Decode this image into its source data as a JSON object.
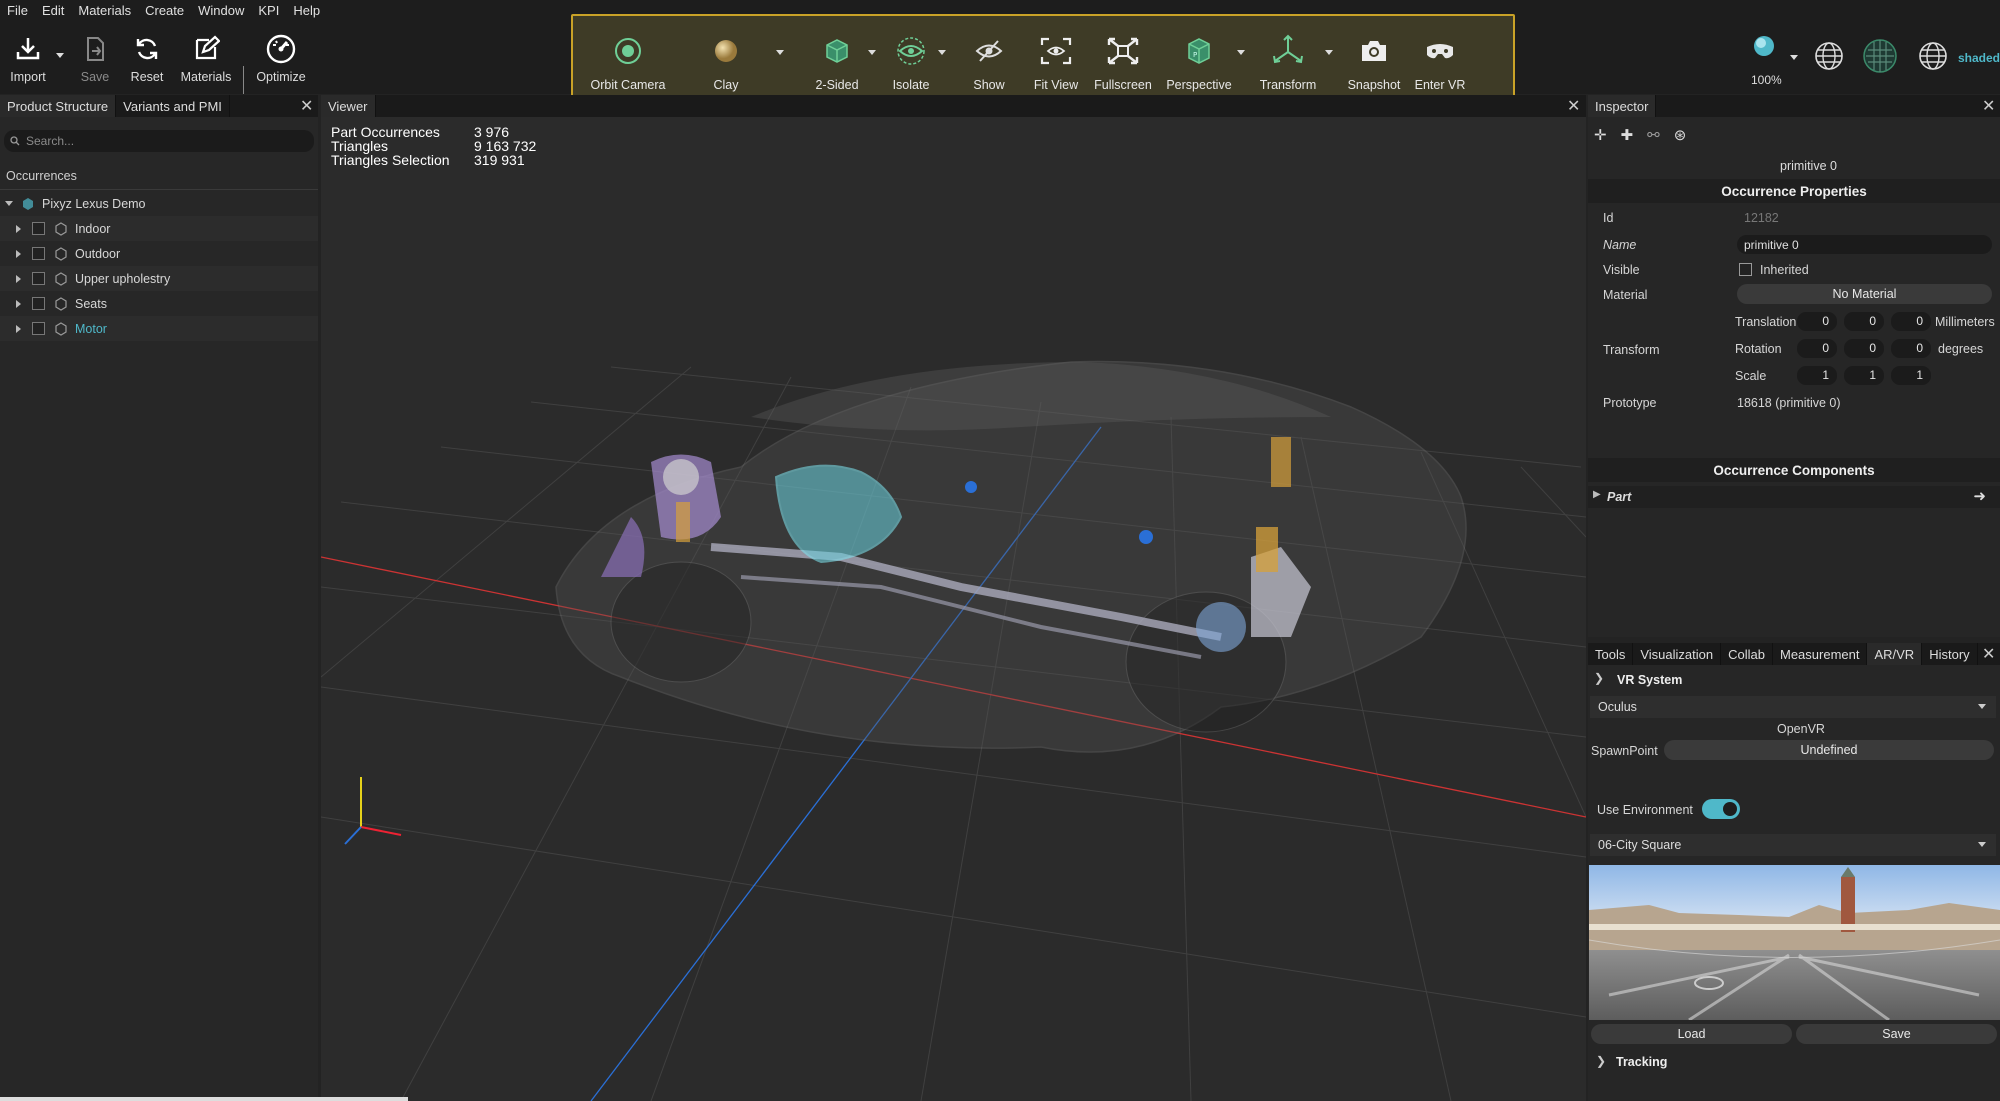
{
  "menu": [
    "File",
    "Edit",
    "Materials",
    "Create",
    "Window",
    "KPI",
    "Help"
  ],
  "toolbar": {
    "import": "Import",
    "save": "Save",
    "reset": "Reset",
    "materials": "Materials",
    "optimize": "Optimize"
  },
  "viewer_tools": {
    "orbit": "Orbit Camera",
    "clay": "Clay",
    "two_sided": "2-Sided",
    "isolate": "Isolate",
    "show": "Show",
    "fit": "Fit View",
    "fullscreen": "Fullscreen",
    "perspective": "Perspective",
    "transform": "Transform",
    "snapshot": "Snapshot",
    "vr": "Enter VR"
  },
  "right_tools": {
    "zoom": "100%",
    "shaded": "shaded"
  },
  "left_panel": {
    "tabs": [
      "Product Structure",
      "Variants and PMI"
    ],
    "search_placeholder": "Search...",
    "occurrences_label": "Occurrences",
    "root": "Pixyz Lexus Demo",
    "items": [
      "Indoor",
      "Outdoor",
      "Upper upholestry",
      "Seats",
      "Motor"
    ]
  },
  "viewer": {
    "tab": "Viewer",
    "stats": [
      {
        "k": "Part Occurrences",
        "v": "3 976"
      },
      {
        "k": "Triangles",
        "v": "9 163 732"
      },
      {
        "k": "Triangles Selection",
        "v": "319 931"
      }
    ]
  },
  "inspector": {
    "tab": "Inspector",
    "title": "primitive 0",
    "occ_props": "Occurrence Properties",
    "id_label": "Id",
    "id_value": "12182",
    "name_label": "Name",
    "name_value": "primitive 0",
    "visible_label": "Visible",
    "inherited": "Inherited",
    "material_label": "Material",
    "material_value": "No Material",
    "transform_label": "Transform",
    "translation": "Translation",
    "translation_values": [
      "0",
      "0",
      "0"
    ],
    "translation_unit": "Millimeters",
    "rotation": "Rotation",
    "rotation_values": [
      "0",
      "0",
      "0"
    ],
    "rotation_unit": "degrees",
    "scale": "Scale",
    "scale_values": [
      "1",
      "1",
      "1"
    ],
    "prototype_label": "Prototype",
    "prototype_value": "18618 (primitive 0)",
    "occ_comps": "Occurrence Components",
    "part": "Part"
  },
  "bottom_panel": {
    "tabs": [
      "Tools",
      "Visualization",
      "Collab",
      "Measurement",
      "AR/VR",
      "History"
    ],
    "vr_system": "VR System",
    "device": "Oculus",
    "runtime": "OpenVR",
    "spawn_label": "SpawnPoint",
    "spawn_value": "Undefined",
    "use_env": "Use Environment",
    "environment": "06-City Square",
    "load": "Load",
    "save": "Save",
    "tracking": "Tracking"
  },
  "colors": {
    "accent": "#4fb8c9",
    "highlight_border": "#c9a227"
  }
}
